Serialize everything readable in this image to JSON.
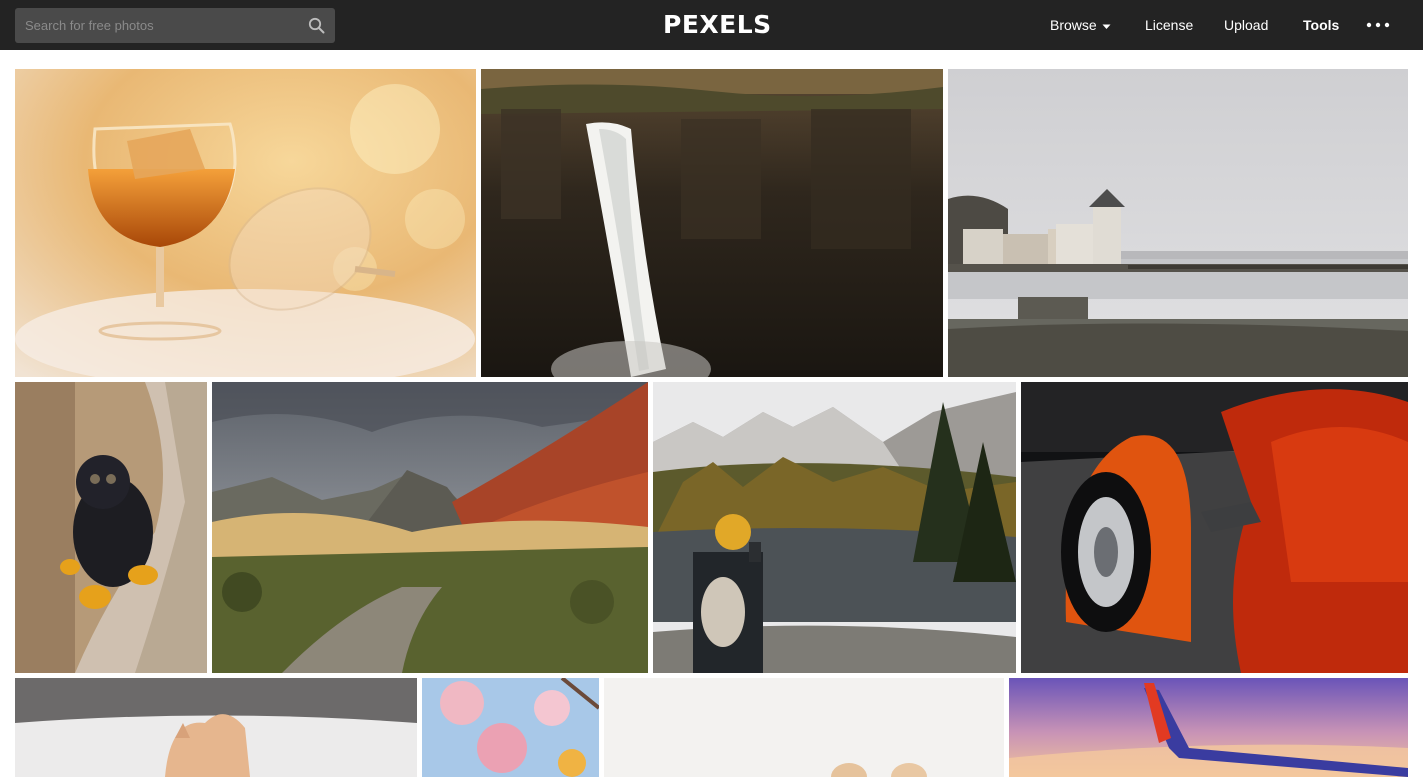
{
  "header": {
    "search_placeholder": "Search for free photos",
    "logo": "PEXELS",
    "nav": {
      "browse": "Browse",
      "license": "License",
      "upload": "Upload",
      "tools": "Tools"
    },
    "icons": {
      "search": "search-icon",
      "browse_caret": "caret-down-icon",
      "more": "more-dots-icon"
    }
  },
  "colors": {
    "header_bg": "#232323",
    "search_bg": "#4a4a4a",
    "page_bg": "#ffffff"
  },
  "gallery": {
    "rows": [
      [
        "brandy-glass",
        "waterfall",
        "coastal-town"
      ],
      [
        "tamarin-monkey",
        "red-rock-canyon",
        "alpine-lake-hiker",
        "orange-hot-rod"
      ],
      [
        "kitten",
        "cherry-blossom",
        "dog-on-white",
        "airplane-wing"
      ]
    ]
  }
}
